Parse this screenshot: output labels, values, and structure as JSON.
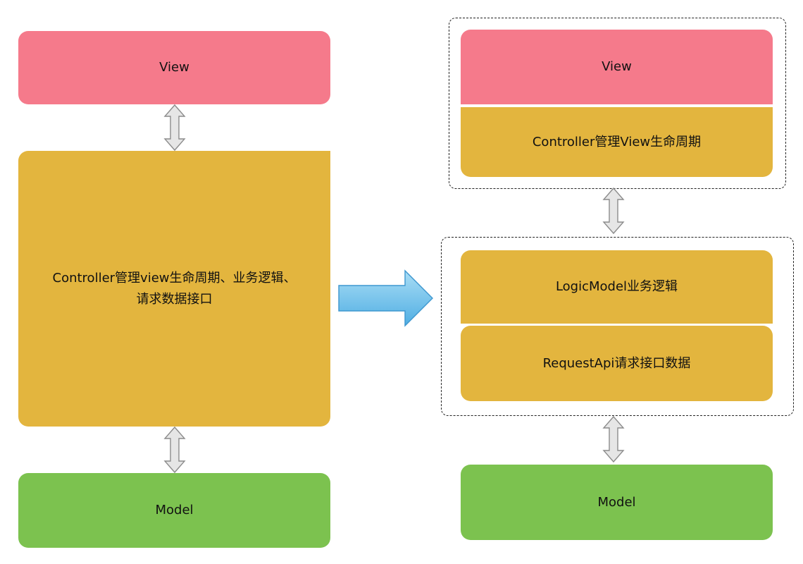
{
  "left": {
    "view_label": "View",
    "controller_line1": "Controller管理view生命周期、业务逻辑、",
    "controller_line2": "请求数据接口",
    "model_label": "Model"
  },
  "right": {
    "view_label": "View",
    "controller_label": "Controller管理View生命周期",
    "logic_label": "LogicModel业务逻辑",
    "request_label": "RequestApi请求接口数据",
    "model_label": "Model"
  },
  "colors": {
    "view": "#F57A8B",
    "controller": "#E3B53E",
    "model": "#7CC24F",
    "transition_arrow": "#5BB9E8",
    "connector_fill": "#E6E6E6",
    "connector_stroke": "#8C8C8C"
  }
}
